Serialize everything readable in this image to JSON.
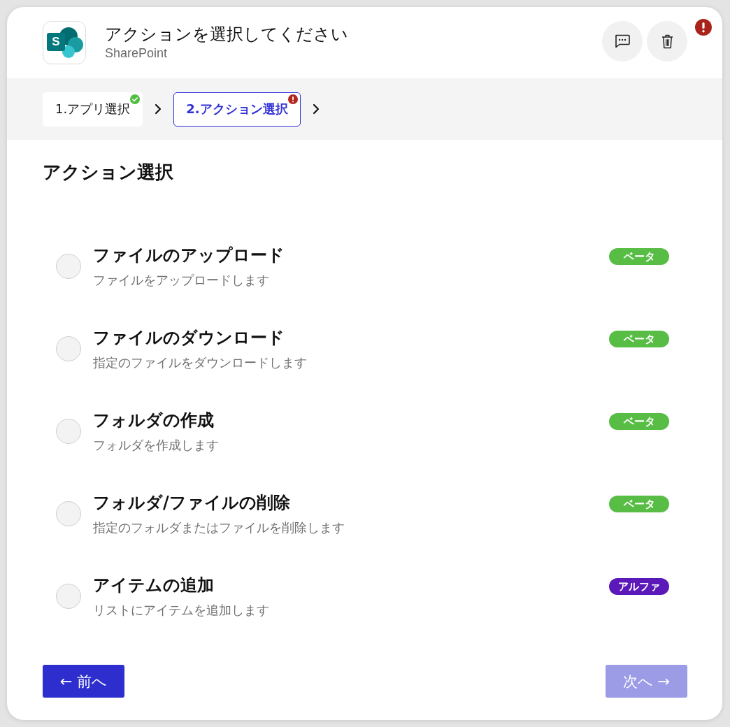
{
  "header": {
    "logo_letter": "S",
    "title": "アクションを選択してください",
    "subtitle": "SharePoint",
    "alert": true
  },
  "steps": [
    {
      "label": "1.アプリ選択",
      "complete": true,
      "error": false,
      "selected": false
    },
    {
      "label": "2.アクション選択",
      "complete": false,
      "error": true,
      "selected": true
    }
  ],
  "section_title": "アクション選択",
  "actions": [
    {
      "title": "ファイルのアップロード",
      "description": "ファイルをアップロードします",
      "selected": false,
      "tag": {
        "label": "ベータ",
        "color": "#58bd45"
      }
    },
    {
      "title": "ファイルのダウンロード",
      "description": "指定のファイルをダウンロードします",
      "selected": false,
      "tag": {
        "label": "ベータ",
        "color": "#58bd45"
      }
    },
    {
      "title": "フォルダの作成",
      "description": "フォルダを作成します",
      "selected": false,
      "tag": {
        "label": "ベータ",
        "color": "#58bd45"
      }
    },
    {
      "title": "フォルダ/ファイルの削除",
      "description": "指定のフォルダまたはファイルを削除します",
      "selected": false,
      "tag": {
        "label": "ベータ",
        "color": "#58bd45"
      }
    },
    {
      "title": "アイテムの追加",
      "description": "リストにアイテムを追加します",
      "selected": false,
      "tag": {
        "label": "アルファ",
        "color": "#5a19b8"
      }
    }
  ],
  "back_button": {
    "label": "← 前へ",
    "disabled": false
  },
  "next_button": {
    "label": "次へ →",
    "disabled": true
  }
}
